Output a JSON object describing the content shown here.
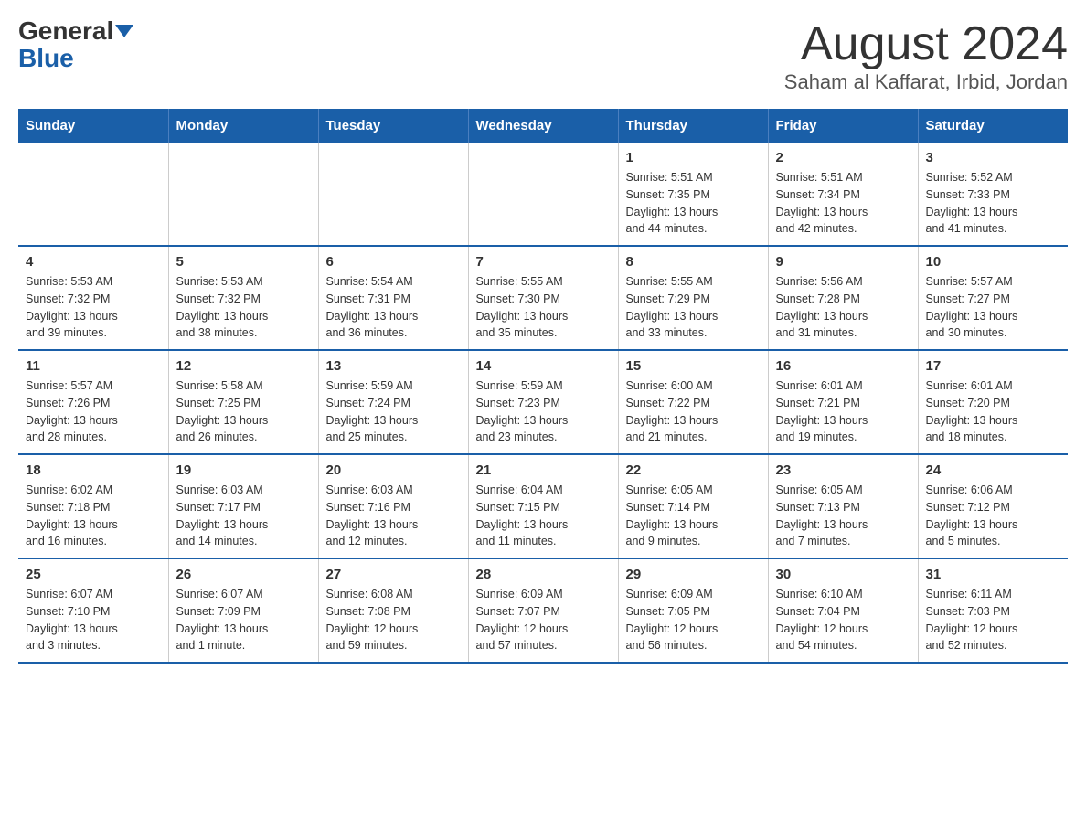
{
  "logo": {
    "part1": "General",
    "part2": "Blue"
  },
  "title": "August 2024",
  "subtitle": "Saham al Kaffarat, Irbid, Jordan",
  "days_of_week": [
    "Sunday",
    "Monday",
    "Tuesday",
    "Wednesday",
    "Thursday",
    "Friday",
    "Saturday"
  ],
  "weeks": [
    [
      {
        "day": "",
        "info": ""
      },
      {
        "day": "",
        "info": ""
      },
      {
        "day": "",
        "info": ""
      },
      {
        "day": "",
        "info": ""
      },
      {
        "day": "1",
        "info": "Sunrise: 5:51 AM\nSunset: 7:35 PM\nDaylight: 13 hours\nand 44 minutes."
      },
      {
        "day": "2",
        "info": "Sunrise: 5:51 AM\nSunset: 7:34 PM\nDaylight: 13 hours\nand 42 minutes."
      },
      {
        "day": "3",
        "info": "Sunrise: 5:52 AM\nSunset: 7:33 PM\nDaylight: 13 hours\nand 41 minutes."
      }
    ],
    [
      {
        "day": "4",
        "info": "Sunrise: 5:53 AM\nSunset: 7:32 PM\nDaylight: 13 hours\nand 39 minutes."
      },
      {
        "day": "5",
        "info": "Sunrise: 5:53 AM\nSunset: 7:32 PM\nDaylight: 13 hours\nand 38 minutes."
      },
      {
        "day": "6",
        "info": "Sunrise: 5:54 AM\nSunset: 7:31 PM\nDaylight: 13 hours\nand 36 minutes."
      },
      {
        "day": "7",
        "info": "Sunrise: 5:55 AM\nSunset: 7:30 PM\nDaylight: 13 hours\nand 35 minutes."
      },
      {
        "day": "8",
        "info": "Sunrise: 5:55 AM\nSunset: 7:29 PM\nDaylight: 13 hours\nand 33 minutes."
      },
      {
        "day": "9",
        "info": "Sunrise: 5:56 AM\nSunset: 7:28 PM\nDaylight: 13 hours\nand 31 minutes."
      },
      {
        "day": "10",
        "info": "Sunrise: 5:57 AM\nSunset: 7:27 PM\nDaylight: 13 hours\nand 30 minutes."
      }
    ],
    [
      {
        "day": "11",
        "info": "Sunrise: 5:57 AM\nSunset: 7:26 PM\nDaylight: 13 hours\nand 28 minutes."
      },
      {
        "day": "12",
        "info": "Sunrise: 5:58 AM\nSunset: 7:25 PM\nDaylight: 13 hours\nand 26 minutes."
      },
      {
        "day": "13",
        "info": "Sunrise: 5:59 AM\nSunset: 7:24 PM\nDaylight: 13 hours\nand 25 minutes."
      },
      {
        "day": "14",
        "info": "Sunrise: 5:59 AM\nSunset: 7:23 PM\nDaylight: 13 hours\nand 23 minutes."
      },
      {
        "day": "15",
        "info": "Sunrise: 6:00 AM\nSunset: 7:22 PM\nDaylight: 13 hours\nand 21 minutes."
      },
      {
        "day": "16",
        "info": "Sunrise: 6:01 AM\nSunset: 7:21 PM\nDaylight: 13 hours\nand 19 minutes."
      },
      {
        "day": "17",
        "info": "Sunrise: 6:01 AM\nSunset: 7:20 PM\nDaylight: 13 hours\nand 18 minutes."
      }
    ],
    [
      {
        "day": "18",
        "info": "Sunrise: 6:02 AM\nSunset: 7:18 PM\nDaylight: 13 hours\nand 16 minutes."
      },
      {
        "day": "19",
        "info": "Sunrise: 6:03 AM\nSunset: 7:17 PM\nDaylight: 13 hours\nand 14 minutes."
      },
      {
        "day": "20",
        "info": "Sunrise: 6:03 AM\nSunset: 7:16 PM\nDaylight: 13 hours\nand 12 minutes."
      },
      {
        "day": "21",
        "info": "Sunrise: 6:04 AM\nSunset: 7:15 PM\nDaylight: 13 hours\nand 11 minutes."
      },
      {
        "day": "22",
        "info": "Sunrise: 6:05 AM\nSunset: 7:14 PM\nDaylight: 13 hours\nand 9 minutes."
      },
      {
        "day": "23",
        "info": "Sunrise: 6:05 AM\nSunset: 7:13 PM\nDaylight: 13 hours\nand 7 minutes."
      },
      {
        "day": "24",
        "info": "Sunrise: 6:06 AM\nSunset: 7:12 PM\nDaylight: 13 hours\nand 5 minutes."
      }
    ],
    [
      {
        "day": "25",
        "info": "Sunrise: 6:07 AM\nSunset: 7:10 PM\nDaylight: 13 hours\nand 3 minutes."
      },
      {
        "day": "26",
        "info": "Sunrise: 6:07 AM\nSunset: 7:09 PM\nDaylight: 13 hours\nand 1 minute."
      },
      {
        "day": "27",
        "info": "Sunrise: 6:08 AM\nSunset: 7:08 PM\nDaylight: 12 hours\nand 59 minutes."
      },
      {
        "day": "28",
        "info": "Sunrise: 6:09 AM\nSunset: 7:07 PM\nDaylight: 12 hours\nand 57 minutes."
      },
      {
        "day": "29",
        "info": "Sunrise: 6:09 AM\nSunset: 7:05 PM\nDaylight: 12 hours\nand 56 minutes."
      },
      {
        "day": "30",
        "info": "Sunrise: 6:10 AM\nSunset: 7:04 PM\nDaylight: 12 hours\nand 54 minutes."
      },
      {
        "day": "31",
        "info": "Sunrise: 6:11 AM\nSunset: 7:03 PM\nDaylight: 12 hours\nand 52 minutes."
      }
    ]
  ]
}
